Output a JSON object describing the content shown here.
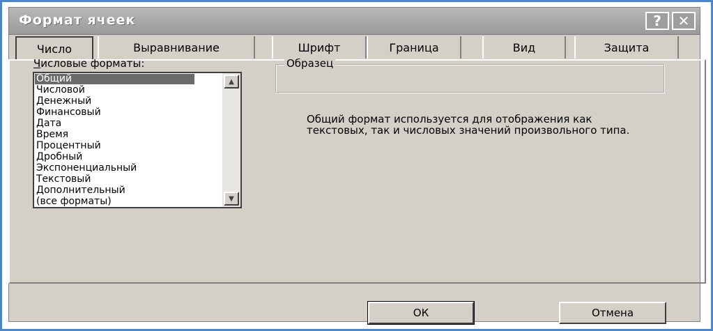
{
  "dialog": {
    "title": "Формат ячеек",
    "help_glyph": "?",
    "close_glyph": "✕"
  },
  "tabs": [
    {
      "label": "Число",
      "active": true
    },
    {
      "label": "Выравнивание",
      "active": false
    },
    {
      "label": "Шрифт",
      "active": false
    },
    {
      "label": "Граница",
      "active": false
    },
    {
      "label": "Вид",
      "active": false
    },
    {
      "label": "Защита",
      "active": false
    }
  ],
  "formats": {
    "label_prefix": "Ч",
    "label_rest": "исловые форматы:",
    "selected": "Общий",
    "items": [
      "Общий",
      "Числовой",
      "Денежный",
      "Финансовый",
      "Дата",
      "Время",
      "Процентный",
      "Дробный",
      "Экспоненциальный",
      "Текстовый",
      "Дополнительный",
      "(все форматы)"
    ]
  },
  "sample": {
    "label": "Образец",
    "value": ""
  },
  "description": "Общий формат используется для отображения как текстовых, так и числовых значений произвольного типа.",
  "buttons": {
    "ok": "ОК",
    "cancel": "Отмена"
  },
  "icons": {
    "scroll_up": "scroll-up-arrow-icon",
    "scroll_down": "scroll-down-arrow-icon"
  }
}
